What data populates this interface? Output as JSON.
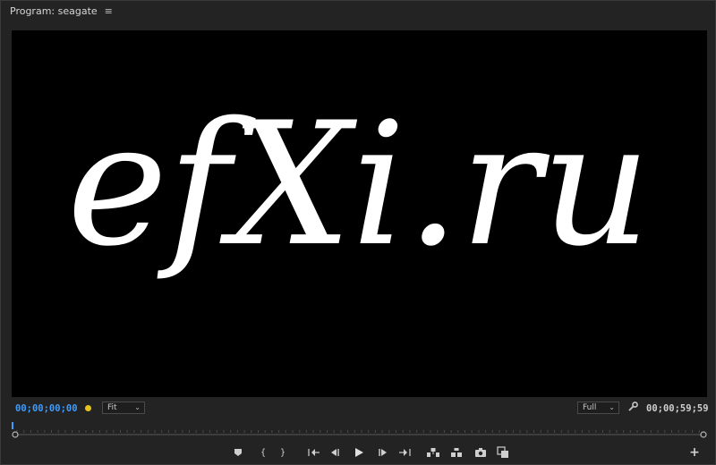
{
  "panel": {
    "title": "Program: seagate",
    "menu_icon": "≡"
  },
  "viewer": {
    "display_text": "efXi.ru"
  },
  "controls": {
    "current_timecode": "00;00;00;00",
    "zoom_select": "Fit",
    "quality_select": "Full",
    "duration_timecode": "00;00;59;59"
  },
  "icons": {
    "wrench": "wrench-icon",
    "marker": "marker-icon",
    "in": "mark-in-icon",
    "out": "mark-out-icon",
    "go_in": "go-to-in-icon",
    "step_back": "step-back-icon",
    "play": "play-icon",
    "step_forward": "step-forward-icon",
    "go_out": "go-to-out-icon",
    "lift": "lift-icon",
    "extract": "extract-icon",
    "export_frame": "camera-icon",
    "compare": "compare-icon",
    "add": "plus-icon"
  },
  "colors": {
    "timecode_active": "#3e9cff",
    "marker_dot": "#e8c21b",
    "background": "#232323"
  },
  "glyphs": {
    "mark_in": "{",
    "mark_out": "}",
    "add": "+",
    "chevron": "⌄"
  }
}
